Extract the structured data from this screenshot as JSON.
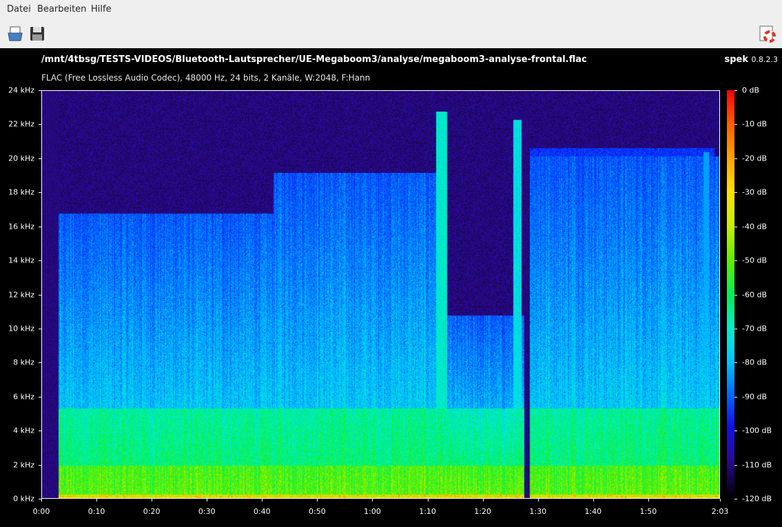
{
  "menu": {
    "file": "Datei",
    "edit": "Bearbeiten",
    "help": "Hilfe"
  },
  "toolbar": {
    "open_icon": "open-file-icon",
    "save_icon": "save-icon",
    "help_icon": "help-lifebuoy-icon"
  },
  "header": {
    "path": "/mnt/4tbsg/TESTS-VIDEOS/Bluetooth-Lautsprecher/UE-Megaboom3/analyse/megaboom3-analyse-frontal.flac",
    "info": "FLAC (Free Lossless Audio Codec), 48000 Hz, 24 bits, 2 Kanäle, W:2048, F:Hann",
    "app": "spek",
    "version": "0.8.2.3"
  },
  "colors": {
    "background": "#000000",
    "frame": "#ffffff",
    "menubar": "#efefef"
  },
  "chart_data": {
    "type": "heatmap",
    "y_ticks": [
      "24 kHz",
      "22 kHz",
      "20 kHz",
      "18 kHz",
      "16 kHz",
      "14 kHz",
      "12 kHz",
      "10 kHz",
      "8 kHz",
      "6 kHz",
      "4 kHz",
      "2 kHz",
      "0 kHz"
    ],
    "x_ticks": [
      "0:00",
      "0:10",
      "0:20",
      "0:30",
      "0:40",
      "0:50",
      "1:00",
      "1:10",
      "1:20",
      "1:30",
      "1:40",
      "1:50",
      "2:03"
    ],
    "db_ticks": [
      "0 dB",
      "-10 dB",
      "-20 dB",
      "-30 dB",
      "-40 dB",
      "-50 dB",
      "-60 dB",
      "-70 dB",
      "-80 dB",
      "-90 dB",
      "-100 dB",
      "-110 dB",
      "-120 dB"
    ],
    "ylim_khz": [
      0,
      24
    ],
    "xlim_s": [
      0,
      123
    ],
    "db_range": [
      -120,
      0
    ],
    "colormap": [
      "#ff0000",
      "#ffa000",
      "#ffe000",
      "#5af000",
      "#00f050",
      "#00f0c8",
      "#00c8ff",
      "#0064ff",
      "#1010f0",
      "#2a0aa0",
      "#000000"
    ]
  }
}
